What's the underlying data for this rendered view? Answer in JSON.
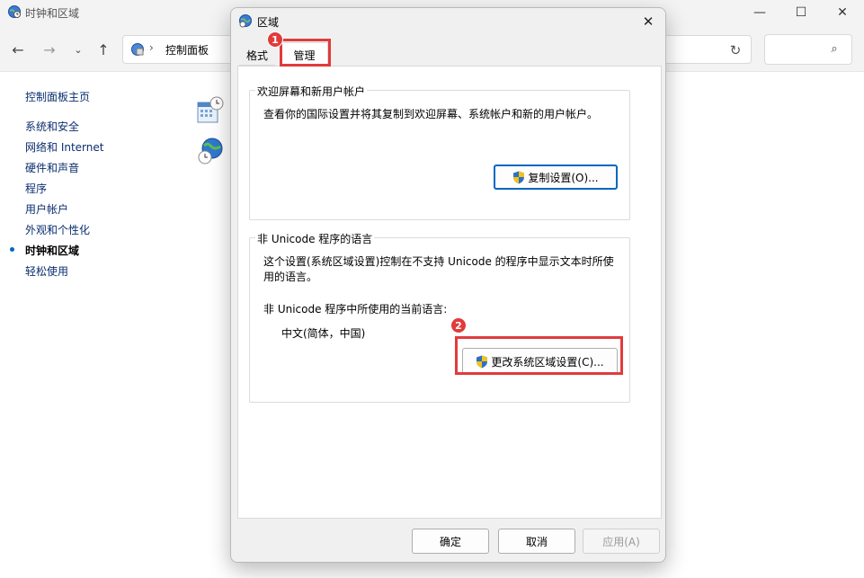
{
  "bg_window": {
    "title": "时钟和区域",
    "breadcrumb": "控制面板",
    "breadcrumb_sep": "›",
    "sidebar": [
      {
        "label": "控制面板主页"
      },
      {
        "label": "系统和安全"
      },
      {
        "label": "网络和 Internet"
      },
      {
        "label": "硬件和声音"
      },
      {
        "label": "程序"
      },
      {
        "label": "用户帐户"
      },
      {
        "label": "外观和个性化"
      },
      {
        "label": "时钟和区域",
        "active": true
      },
      {
        "label": "轻松使用"
      }
    ]
  },
  "dialog": {
    "title": "区域",
    "tabs": [
      "格式",
      "管理"
    ],
    "active_tab": "管理",
    "welcome_group": {
      "legend": "欢迎屏幕和新用户帐户",
      "description": "查看你的国际设置并将其复制到欢迎屏幕、系统帐户和新的用户帐户。",
      "button": "复制设置(O)..."
    },
    "unicode_group": {
      "legend": "非 Unicode 程序的语言",
      "description": "这个设置(系统区域设置)控制在不支持 Unicode 的程序中显示文本时所使用的语言。",
      "current_label": "非 Unicode 程序中所使用的当前语言:",
      "current_value": "中文(简体，中国)",
      "button": "更改系统区域设置(C)..."
    },
    "buttons": {
      "ok": "确定",
      "cancel": "取消",
      "apply": "应用(A)"
    }
  },
  "annotations": {
    "badge1": "1",
    "badge2": "2",
    "color": "#e13b3b"
  }
}
